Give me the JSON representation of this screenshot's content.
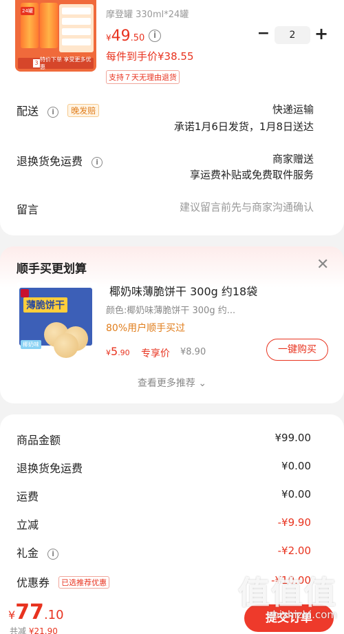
{
  "product": {
    "spec": "摩登罐 330ml*24罐",
    "price": {
      "currency": "¥",
      "integer": "49",
      "decimal": ".50"
    },
    "info_icon": "info-icon",
    "final_price": "每件到手价¥38.55",
    "return_policy": "支持７天无理由退货",
    "quantity": "2",
    "minus_label": "−",
    "plus_label": "+"
  },
  "shipping": {
    "label": "配送",
    "tag": "晚发赔",
    "method": "快递运输",
    "promise": "承诺1月6日发货，1月8日送达"
  },
  "return_shipping": {
    "label": "退换货免运费",
    "value": "商家赠送",
    "desc": "享运费补贴或免费取件服务"
  },
  "note": {
    "label": "留言",
    "placeholder": "建议留言前先与商家沟通确认"
  },
  "recommend": {
    "title": "顺手买更划算",
    "close_icon": "close-icon",
    "item": {
      "name": "椰奶味薄脆饼干 300g 约18袋",
      "spec": "颜色:椰奶味薄脆饼干 300g 约...",
      "users": "80%用户顺手买过",
      "price": {
        "currency": "¥",
        "integer": "5",
        "decimal": ".90"
      },
      "exclusive_label": "专享价",
      "original_price": "¥8.90",
      "buy_label": "一键购买"
    },
    "more_label": "查看更多推荐 ⌄"
  },
  "summary": [
    {
      "label": "商品金额",
      "value": "¥99.00",
      "color": "#222222"
    },
    {
      "label": "退换货免运费",
      "value": "¥0.00",
      "color": "#222222"
    },
    {
      "label": "运费",
      "value": "¥0.00",
      "color": "#222222"
    },
    {
      "label": "立减",
      "value": "-¥9.90",
      "color": "#e8331f"
    },
    {
      "label": "礼金",
      "value": "-¥2.00",
      "color": "#e8331f"
    },
    {
      "label": "优惠券",
      "value": "-¥10.00",
      "color": "#e8331f",
      "tag": "已选推荐优惠"
    }
  ],
  "footer": {
    "total": {
      "currency": "¥",
      "integer": "77",
      "decimal": ".10"
    },
    "saved_label": "共减",
    "saved_value": "¥21.90",
    "submit_label": "提交订单"
  },
  "watermark": {
    "logo": "值值值",
    "url": "zhizhizhi.com"
  },
  "colors": {
    "accent": "#e8331f",
    "warning": "#e07d1b",
    "muted": "#888888"
  }
}
